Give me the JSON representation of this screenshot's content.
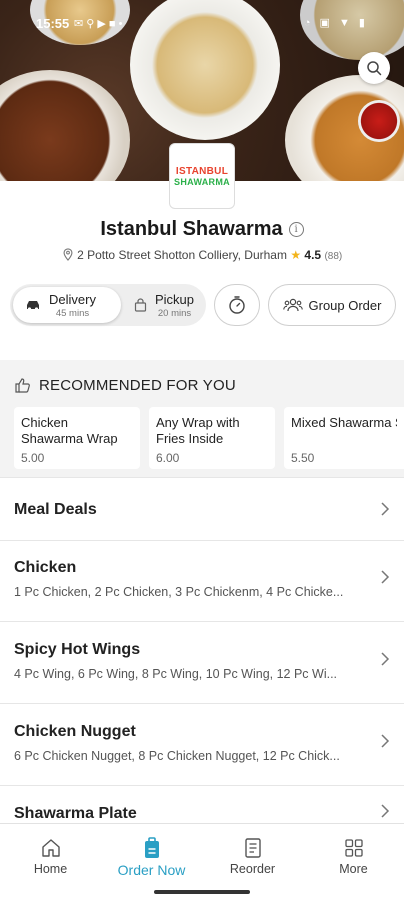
{
  "status_bar": {
    "time": "15:55"
  },
  "restaurant": {
    "logo_line1": "ISTANBUL",
    "logo_line2": "SHAWARMA",
    "name": "Istanbul Shawarma",
    "address": "2 Potto Street Shotton Colliery, Durham",
    "rating": "4.5",
    "rating_count": "(88)"
  },
  "order_options": {
    "delivery": {
      "label": "Delivery",
      "time": "45 mins",
      "selected": true
    },
    "pickup": {
      "label": "Pickup",
      "time": "20 mins",
      "selected": false
    },
    "group_order_label": "Group Order"
  },
  "recommended": {
    "title": "RECOMMENDED FOR YOU",
    "items": [
      {
        "name": "Chicken Shawarma Wrap",
        "price": "5.00"
      },
      {
        "name": "Any Wrap with Fries Inside",
        "price": "6.00"
      },
      {
        "name": "Mixed Shawarma Sandwich",
        "price": "5.50"
      }
    ]
  },
  "categories": [
    {
      "title": "Meal Deals",
      "desc": ""
    },
    {
      "title": "Chicken",
      "desc": "1 Pc Chicken, 2 Pc Chicken, 3 Pc Chickenm, 4 Pc Chicke..."
    },
    {
      "title": "Spicy Hot Wings",
      "desc": "4 Pc Wing, 6 Pc Wing, 8 Pc Wing, 10 Pc Wing, 12 Pc Wi..."
    },
    {
      "title": "Chicken Nugget",
      "desc": "6 Pc Chicken Nugget, 8 Pc Chicken Nugget, 12 Pc Chick..."
    },
    {
      "title": "Shawarma Plate",
      "desc": ""
    }
  ],
  "bottom_nav": [
    {
      "label": "Home",
      "icon": "home-icon"
    },
    {
      "label": "Order Now",
      "icon": "order-bag-icon",
      "active": true
    },
    {
      "label": "Reorder",
      "icon": "receipt-icon"
    },
    {
      "label": "More",
      "icon": "grid-icon"
    }
  ],
  "colors": {
    "accent": "#2a9fc4",
    "star": "#f3b41b",
    "logo_red": "#e8432e",
    "logo_green": "#2bb04a"
  }
}
